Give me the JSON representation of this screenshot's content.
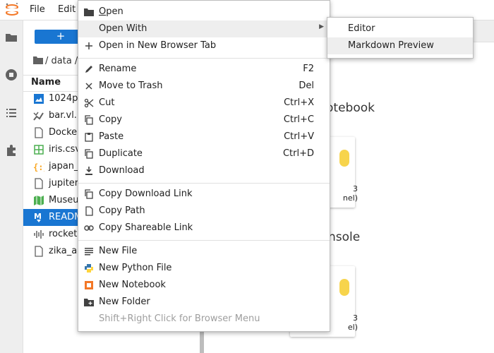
{
  "menubar": {
    "items": [
      "File",
      "Edit"
    ]
  },
  "sidebar": {
    "icons": [
      "folder-icon",
      "running-icon",
      "toc-icon",
      "extension-icon"
    ]
  },
  "filebrowser": {
    "new_label": "+",
    "breadcrumb": "/ data /",
    "column_header": "Name",
    "files": [
      {
        "name": "1024p",
        "icon": "image-icon"
      },
      {
        "name": "bar.vl.",
        "icon": "vega-icon"
      },
      {
        "name": "Docke",
        "icon": "file-icon"
      },
      {
        "name": "iris.csv",
        "icon": "csv-icon"
      },
      {
        "name": "japan_",
        "icon": "json-icon"
      },
      {
        "name": "jupiter",
        "icon": "file-icon"
      },
      {
        "name": "Museu",
        "icon": "geojson-icon"
      },
      {
        "name": "READM",
        "icon": "markdown-icon",
        "selected": true
      },
      {
        "name": "rocket",
        "icon": "audio-icon"
      },
      {
        "name": "zika_a",
        "icon": "file-icon"
      }
    ]
  },
  "launcher": {
    "notebook_title": "otebook",
    "console_title": "nsole",
    "card_label_line1": "3",
    "card_label_line2": "nel)",
    "card2_label_line2": "el)"
  },
  "context_menu": {
    "open": "Open",
    "open_with": "Open With",
    "open_new_tab": "Open in New Browser Tab",
    "rename": "Rename",
    "rename_kb": "F2",
    "trash": "Move to Trash",
    "trash_kb": "Del",
    "cut": "Cut",
    "cut_kb": "Ctrl+X",
    "copy": "Copy",
    "copy_kb": "Ctrl+C",
    "paste": "Paste",
    "paste_kb": "Ctrl+V",
    "duplicate": "Duplicate",
    "duplicate_kb": "Ctrl+D",
    "download": "Download",
    "copy_download_link": "Copy Download Link",
    "copy_path": "Copy Path",
    "copy_shareable_link": "Copy Shareable Link",
    "new_file": "New File",
    "new_python_file": "New Python File",
    "new_notebook": "New Notebook",
    "new_folder": "New Folder",
    "browser_menu_hint": "Shift+Right Click for Browser Menu"
  },
  "submenu": {
    "editor": "Editor",
    "markdown_preview": "Markdown Preview"
  },
  "colors": {
    "accent": "#1976d2",
    "jupyter_orange": "#f37726",
    "python_blue": "#3776ab",
    "python_yellow": "#ffd43b"
  }
}
